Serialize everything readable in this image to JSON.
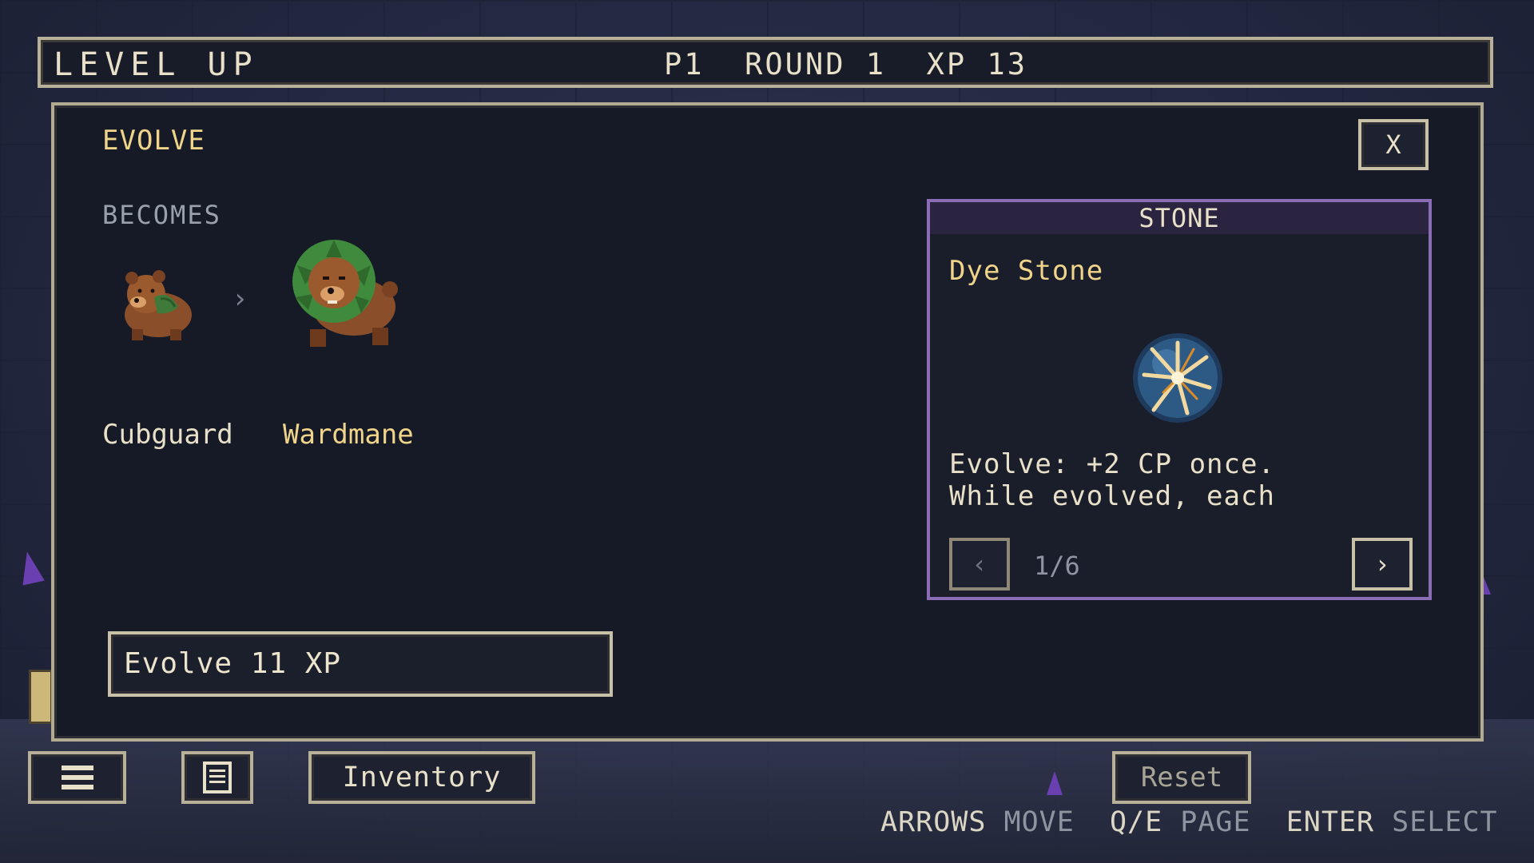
{
  "topbar": {
    "title": "LEVEL UP",
    "stats": "P1  ROUND 1  XP 13"
  },
  "panel": {
    "title": "EVOLVE",
    "close_label": "X",
    "becomes_label": "BECOMES",
    "from_name": "Cubguard",
    "to_name": "Wardmane",
    "evolve_button": "Evolve 11 XP"
  },
  "card": {
    "category": "STONE",
    "name": "Dye Stone",
    "desc_line1": "Evolve: +2 CP once.",
    "desc_line2": "While evolved, each",
    "page": "1/6",
    "prev_icon": "chevron-left-icon",
    "next_icon": "chevron-right-icon"
  },
  "bottombar": {
    "inventory_label": "Inventory",
    "reset_label": "Reset",
    "hints": [
      {
        "key": "ARROWS",
        "action": "MOVE"
      },
      {
        "key": "Q/E",
        "action": "PAGE"
      },
      {
        "key": "ENTER",
        "action": "SELECT"
      }
    ]
  },
  "colors": {
    "accent_gold": "#f0d48a",
    "card_border": "#8a6db5",
    "panel_bg": "#161a26"
  }
}
